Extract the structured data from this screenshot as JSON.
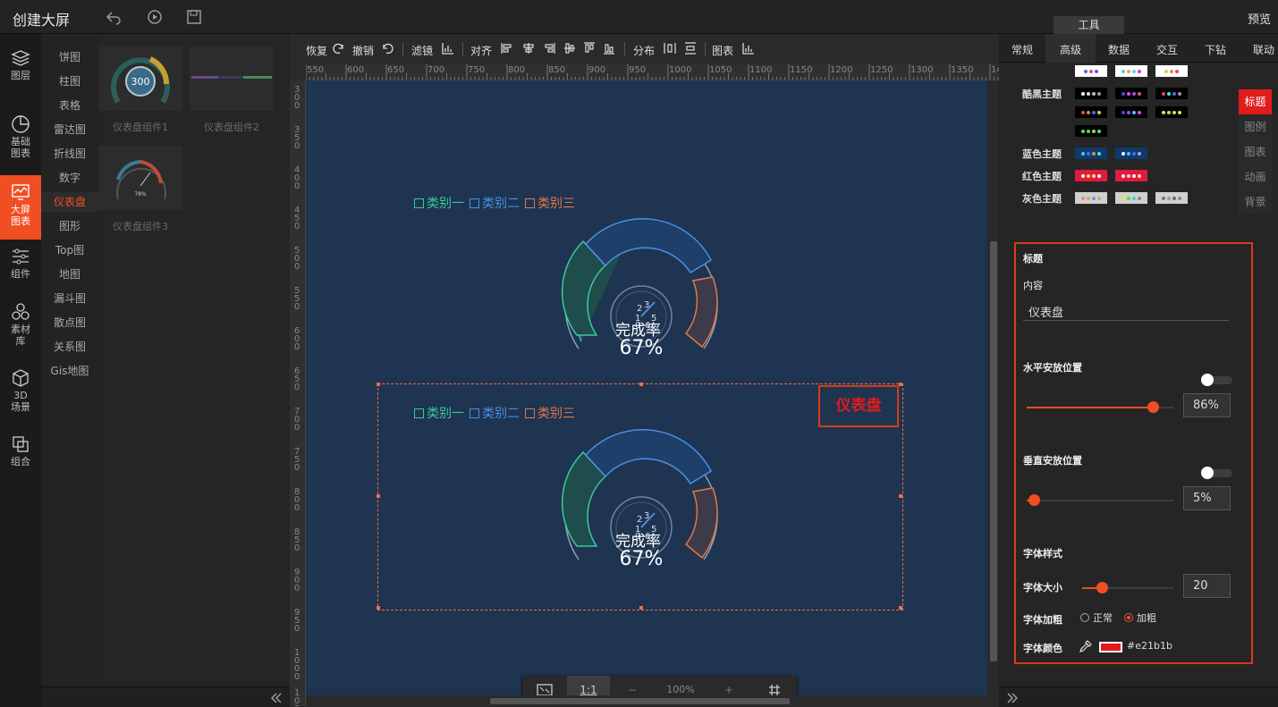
{
  "app": {
    "title": "创建大屏",
    "preview": "预览",
    "tools_tab": "工具"
  },
  "nav": {
    "layers": "图层",
    "basic_chart": [
      "基础",
      "图表"
    ],
    "bigscreen_chart": [
      "大屏",
      "图表"
    ],
    "components": "组件",
    "materials": [
      "素材",
      "库"
    ],
    "scene3d": [
      "3D",
      "场景"
    ],
    "group": "组合"
  },
  "categories": [
    "饼图",
    "柱图",
    "表格",
    "雷达图",
    "折线图",
    "数字",
    "仪表盘",
    "图形",
    "Top图",
    "地图",
    "漏斗图",
    "散点图",
    "关系图",
    "Gis地图"
  ],
  "thumbs": {
    "t1": {
      "label": "仪表盘组件1",
      "value": "300"
    },
    "t2": {
      "label": "仪表盘组件2"
    },
    "t3": {
      "label": "仪表盘组件3",
      "value": "78%"
    }
  },
  "toolbar": {
    "redo": "恢复",
    "undo": "撤销",
    "filter": "滤镜",
    "align": "对齐",
    "distribute": "分布",
    "chart": "图表"
  },
  "ruler": {
    "h": [
      "550",
      "600",
      "650",
      "700",
      "750",
      "800",
      "850",
      "900",
      "950",
      "1000",
      "1050",
      "1100",
      "1150",
      "1200",
      "1250",
      "1300",
      "1350",
      "14"
    ],
    "v": [
      "3\n0\n0",
      "3\n5\n0",
      "4\n0\n0",
      "4\n5\n0",
      "5\n0\n0",
      "5\n5\n0",
      "6\n0\n0",
      "6\n5\n0",
      "7\n0\n0",
      "7\n5\n0",
      "8\n0\n0",
      "8\n5\n0",
      "9\n0\n0",
      "9\n5\n0",
      "1\n0\n0\n0",
      "1\n0\n5"
    ]
  },
  "gauge": {
    "legend": [
      "类别一",
      "类别二",
      "类别三"
    ],
    "legend_colors": [
      "#3cc99a",
      "#4a90e2",
      "#e0784a"
    ],
    "percent": "67%",
    "sub": "完成率",
    "center_digits": [
      "2",
      "3",
      "1",
      "5",
      "0",
      "6"
    ]
  },
  "selected": {
    "title": "仪表盘"
  },
  "zoom": {
    "fit": "",
    "one_to_one": "1:1",
    "minus": "−",
    "value": "100%",
    "plus": "+",
    "grid": ""
  },
  "right": {
    "tabs": [
      "常规",
      "高级",
      "数据",
      "交互",
      "下钻",
      "联动"
    ],
    "active_tab": "高级",
    "themes": {
      "cool_black": "酷黑主题",
      "blue": "蓝色主题",
      "red": "红色主题",
      "gray": "灰色主题"
    },
    "vtabs": [
      "标题",
      "图例",
      "图表",
      "动画",
      "背景"
    ],
    "panel": {
      "section": "标题",
      "content_label": "内容",
      "content_value": "仪表盘",
      "h_pos_label": "水平安放位置",
      "h_pos_value": "86%",
      "v_pos_label": "垂直安放位置",
      "v_pos_value": "5%",
      "font_style_label": "字体样式",
      "font_size_label": "字体大小",
      "font_size_value": "20",
      "font_weight_label": "字体加粗",
      "weight_normal": "正常",
      "weight_bold": "加粗",
      "font_color_label": "字体颜色",
      "font_color_value": "#e21b1b"
    }
  },
  "colors": {
    "accent": "#f04e23",
    "canvas": "#1e3450",
    "title_red": "#e21b1b"
  }
}
